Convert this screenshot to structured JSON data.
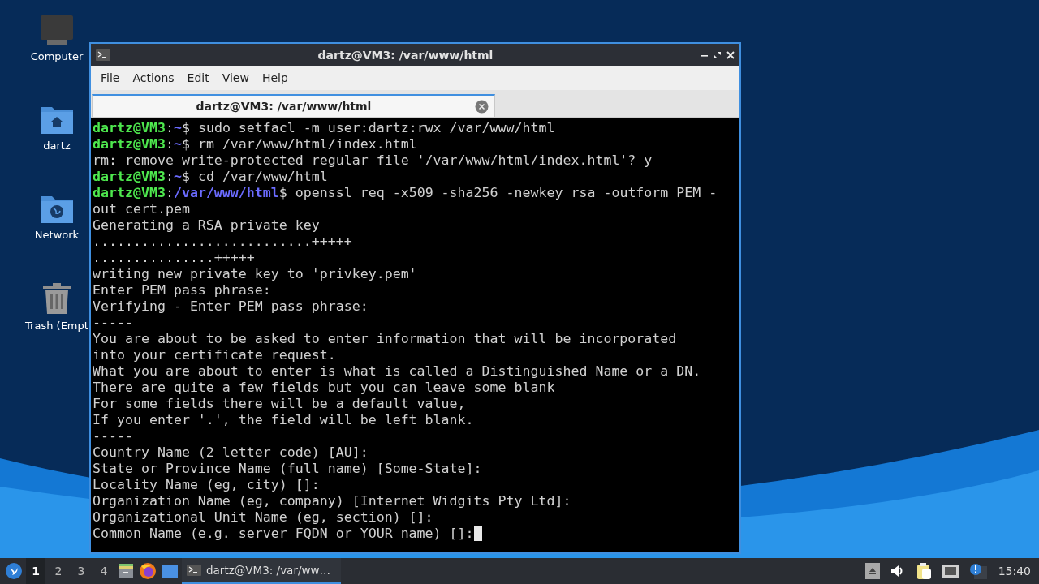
{
  "desktop_icons": [
    {
      "label": "Computer",
      "kind": "computer"
    },
    {
      "label": "dartz",
      "kind": "home"
    },
    {
      "label": "Network",
      "kind": "network"
    },
    {
      "label": "Trash (Empt",
      "kind": "trash"
    }
  ],
  "window": {
    "title": "dartz@VM3: /var/www/html",
    "menu": [
      "File",
      "Actions",
      "Edit",
      "View",
      "Help"
    ],
    "tabs": [
      {
        "label": "dartz@VM3: /var/www/html",
        "selected": true
      }
    ],
    "terminal": {
      "lines": [
        {
          "kind": "prompt",
          "user": "dartz@VM3",
          "colon": ":",
          "path": "~",
          "dollar": "$",
          "command": "sudo setfacl -m user:dartz:rwx /var/www/html"
        },
        {
          "kind": "prompt",
          "user": "dartz@VM3",
          "colon": ":",
          "path": "~",
          "dollar": "$",
          "command": "rm /var/www/html/index.html"
        },
        {
          "kind": "output",
          "text": "rm: remove write-protected regular file '/var/www/html/index.html'? y"
        },
        {
          "kind": "prompt",
          "user": "dartz@VM3",
          "colon": ":",
          "path": "~",
          "dollar": "$",
          "command": "cd /var/www/html"
        },
        {
          "kind": "prompt",
          "user": "dartz@VM3",
          "colon": ":",
          "path": "/var/www/html",
          "dollar": "$",
          "command": "openssl req -x509 -sha256 -newkey rsa -outform PEM -"
        },
        {
          "kind": "output",
          "text": "out cert.pem"
        },
        {
          "kind": "output",
          "text": "Generating a RSA private key"
        },
        {
          "kind": "output",
          "text": "...........................+++++"
        },
        {
          "kind": "output",
          "text": "...............+++++"
        },
        {
          "kind": "output",
          "text": "writing new private key to 'privkey.pem'"
        },
        {
          "kind": "output",
          "text": "Enter PEM pass phrase:"
        },
        {
          "kind": "output",
          "text": "Verifying - Enter PEM pass phrase:"
        },
        {
          "kind": "output",
          "text": "-----"
        },
        {
          "kind": "output",
          "text": "You are about to be asked to enter information that will be incorporated"
        },
        {
          "kind": "output",
          "text": "into your certificate request."
        },
        {
          "kind": "output",
          "text": "What you are about to enter is what is called a Distinguished Name or a DN."
        },
        {
          "kind": "output",
          "text": "There are quite a few fields but you can leave some blank"
        },
        {
          "kind": "output",
          "text": "For some fields there will be a default value,"
        },
        {
          "kind": "output",
          "text": "If you enter '.', the field will be left blank."
        },
        {
          "kind": "output",
          "text": "-----"
        },
        {
          "kind": "output",
          "text": "Country Name (2 letter code) [AU]:"
        },
        {
          "kind": "output",
          "text": "State or Province Name (full name) [Some-State]:"
        },
        {
          "kind": "output",
          "text": "Locality Name (eg, city) []:"
        },
        {
          "kind": "output",
          "text": "Organization Name (eg, company) [Internet Widgits Pty Ltd]:"
        },
        {
          "kind": "output",
          "text": "Organizational Unit Name (eg, section) []:"
        },
        {
          "kind": "input",
          "text": "Common Name (e.g. server FQDN or YOUR name) []:"
        }
      ]
    }
  },
  "taskbar": {
    "workspaces": [
      {
        "label": "1",
        "selected": true
      },
      {
        "label": "2",
        "selected": false
      },
      {
        "label": "3",
        "selected": false
      },
      {
        "label": "4",
        "selected": false
      }
    ],
    "tasks": [
      {
        "label": "dartz@VM3: /var/ww…",
        "selected": true
      }
    ],
    "clock": "15:40"
  }
}
